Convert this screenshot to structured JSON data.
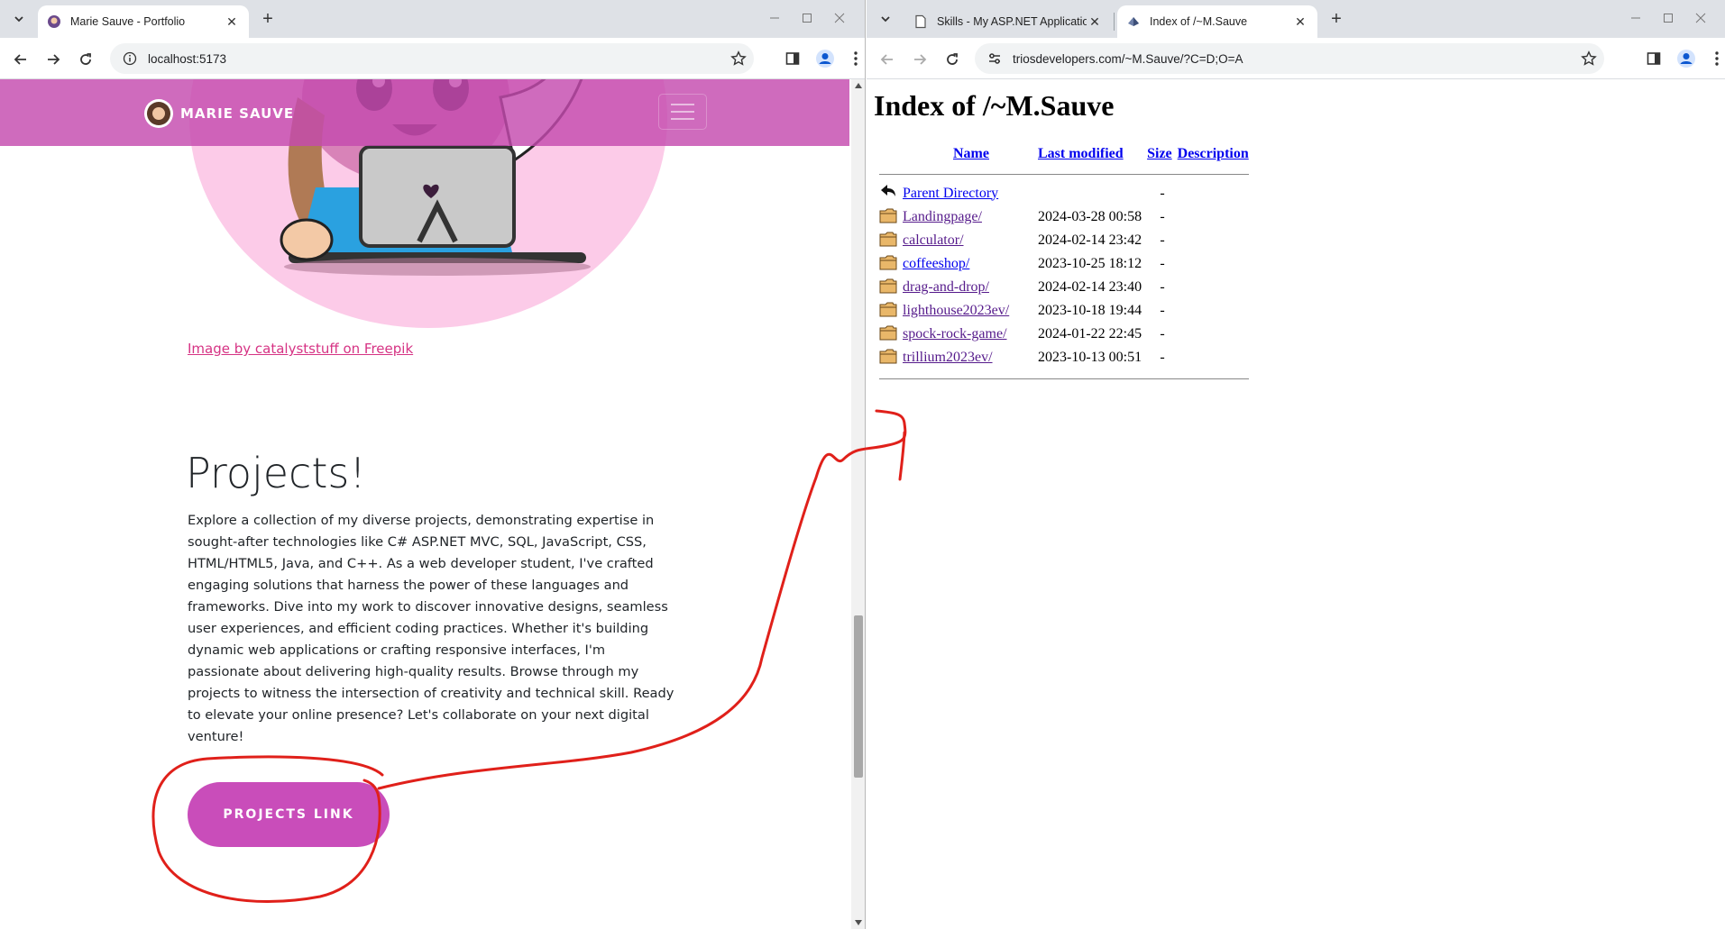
{
  "left_window": {
    "tab": {
      "title": "Marie Sauve - Portfolio",
      "close": "✕"
    },
    "url": "localhost:5173",
    "site": {
      "brand": "MARIE SAUVE",
      "image_credit": "Image by catalyststuff on Freepik",
      "projects_heading": "Projects!",
      "projects_text": "Explore a collection of my diverse projects, demonstrating expertise in sought-after technologies like C# ASP.NET MVC, SQL, JavaScript, CSS, HTML/HTML5, Java, and C++. As a web developer student, I've crafted engaging solutions that harness the power of these languages and frameworks. Dive into my work to discover innovative designs, seamless user experiences, and efficient coding practices. Whether it's building dynamic web applications or crafting responsive interfaces, I'm passionate about delivering high-quality results. Browse through my projects to witness the intersection of creativity and technical skill. Ready to elevate your online presence? Let's collaborate on your next digital venture!",
      "projects_button": "PROJECTS LINK"
    }
  },
  "right_window": {
    "tabs": [
      {
        "title": "Skills - My ASP.NET Application",
        "close": "✕"
      },
      {
        "title": "Index of /~M.Sauve",
        "close": "✕"
      }
    ],
    "url": "triosdevelopers.com/~M.Sauve/?C=D;O=A",
    "index": {
      "heading": "Index of /~M.Sauve",
      "columns": {
        "name": "Name",
        "modified": "Last modified",
        "size": "Size",
        "description": "Description"
      },
      "parent": {
        "name": "Parent Directory",
        "size": "-"
      },
      "rows": [
        {
          "name": "Landingpage/",
          "modified": "2024-03-28 00:58",
          "size": "-"
        },
        {
          "name": "calculator/",
          "modified": "2024-02-14 23:42",
          "size": "-"
        },
        {
          "name": "coffeeshop/",
          "modified": "2023-10-25 18:12",
          "size": "-"
        },
        {
          "name": "drag-and-drop/",
          "modified": "2024-02-14 23:40",
          "size": "-"
        },
        {
          "name": "lighthouse2023ev/",
          "modified": "2023-10-18 19:44",
          "size": "-"
        },
        {
          "name": "spock-rock-game/",
          "modified": "2024-01-22 22:45",
          "size": "-"
        },
        {
          "name": "trillium2023ev/",
          "modified": "2023-10-13 00:51",
          "size": "-"
        }
      ]
    }
  },
  "colors": {
    "nav_bg": "#c44baf",
    "button_bg": "#c94dba",
    "credit_link": "#d63384",
    "annotation": "#e0201a"
  },
  "icons": [
    "tab-list-icon",
    "back-icon",
    "forward-icon",
    "reload-icon",
    "info-icon",
    "site-settings-icon",
    "star-icon",
    "sidebar-icon",
    "profile-icon",
    "menu-icon",
    "folder-icon",
    "back-arrow-icon"
  ]
}
